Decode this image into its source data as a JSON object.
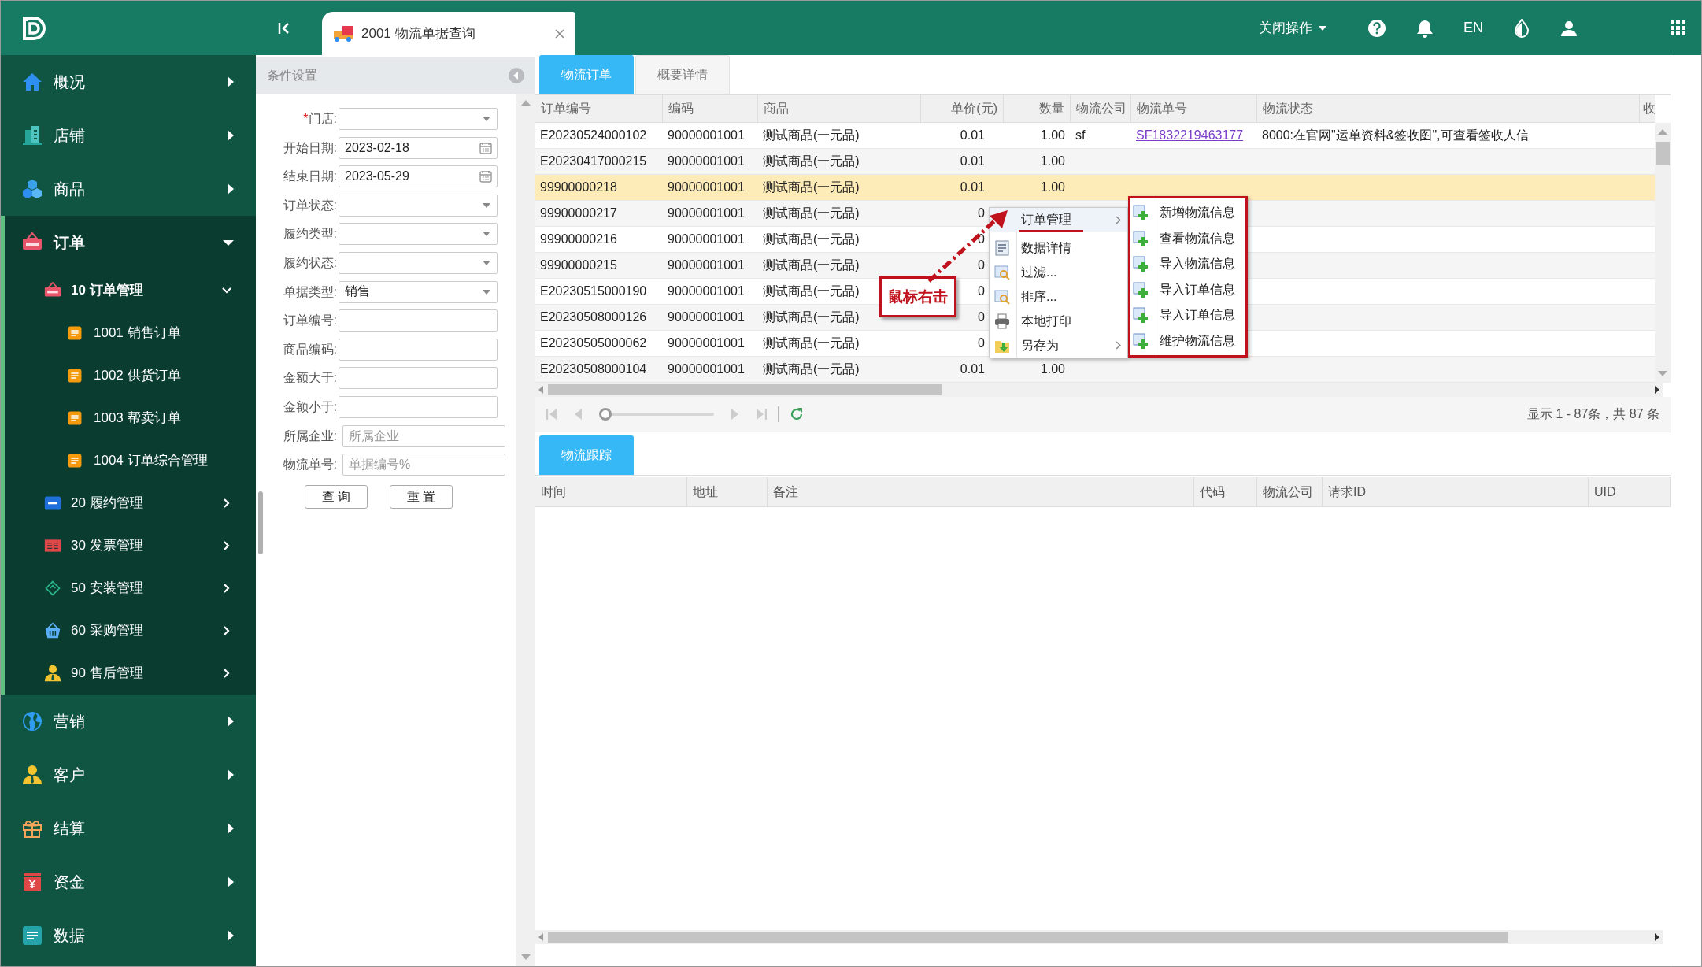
{
  "header": {
    "tab": {
      "title": "2001 物流单据查询"
    },
    "close_ops": "关闭操作",
    "language": "EN"
  },
  "sidebar": {
    "items": [
      {
        "label": "概况",
        "expanded": false
      },
      {
        "label": "店铺",
        "expanded": false
      },
      {
        "label": "商品",
        "expanded": false
      },
      {
        "label": "订单",
        "expanded": true,
        "children": [
          {
            "label": "10 订单管理",
            "expanded": true,
            "children": [
              {
                "label": "1001 销售订单"
              },
              {
                "label": "1002 供货订单"
              },
              {
                "label": "1003 帮卖订单"
              },
              {
                "label": "1004 订单综合管理"
              }
            ]
          },
          {
            "label": "20 履约管理",
            "expanded": false
          },
          {
            "label": "30 发票管理",
            "expanded": false
          },
          {
            "label": "50 安装管理",
            "expanded": false
          },
          {
            "label": "60 采购管理",
            "expanded": false
          },
          {
            "label": "90 售后管理",
            "expanded": false
          }
        ]
      },
      {
        "label": "营销",
        "expanded": false
      },
      {
        "label": "客户",
        "expanded": false
      },
      {
        "label": "结算",
        "expanded": false
      },
      {
        "label": "资金",
        "expanded": false
      },
      {
        "label": "数据",
        "expanded": false
      }
    ]
  },
  "filter_panel": {
    "title": "条件设置",
    "fields": [
      {
        "label": "门店:",
        "required_mark": "*",
        "kind": "select"
      },
      {
        "label": "开始日期:",
        "kind": "date",
        "value": "2023-02-18"
      },
      {
        "label": "结束日期:",
        "kind": "date",
        "value": "2023-05-29"
      },
      {
        "label": "订单状态:",
        "kind": "select"
      },
      {
        "label": "履约类型:",
        "kind": "select"
      },
      {
        "label": "履约状态:",
        "kind": "select"
      },
      {
        "label": "单据类型:",
        "kind": "select",
        "value": "销售"
      },
      {
        "label": "订单编号:",
        "kind": "text"
      },
      {
        "label": "商品编码:",
        "kind": "text"
      },
      {
        "label": "金额大于:",
        "kind": "text"
      },
      {
        "label": "金额小于:",
        "kind": "text"
      },
      {
        "label": "所属企业:",
        "kind": "text",
        "placeholder": "所属企业"
      },
      {
        "label": "物流单号:",
        "kind": "text",
        "placeholder": "单据编号%"
      }
    ],
    "buttons": [
      "查 询",
      "重 置"
    ]
  },
  "main": {
    "tabs": [
      {
        "label": "物流订单",
        "selected": true
      },
      {
        "label": "概要详情",
        "selected": false
      }
    ],
    "table": {
      "columns": [
        "订单编号",
        "编码",
        "商品",
        "单价(元)",
        "数量",
        "物流公司",
        "物流单号",
        "物流状态",
        "收"
      ],
      "rows": [
        {
          "selected": false,
          "order_no": "E20230524000102",
          "code": "90000001001",
          "product": "测试商品(一元品)",
          "price": "0.01",
          "qty": "1.00",
          "carrier": "sf",
          "tracking_no": "SF1832219463177",
          "status": "8000:在官网\"运单资料&签收图\",可查看签收人信"
        },
        {
          "selected": false,
          "order_no": "E20230417000215",
          "code": "90000001001",
          "product": "测试商品(一元品)",
          "price": "0.01",
          "qty": "1.00"
        },
        {
          "selected": true,
          "order_no": "99900000218",
          "code": "90000001001",
          "product": "测试商品(一元品)",
          "price": "0.01",
          "qty": "1.00"
        },
        {
          "selected": false,
          "order_no": "99900000217",
          "code": "90000001001",
          "product": "测试商品(一元品)",
          "price": "0"
        },
        {
          "selected": false,
          "order_no": "99900000216",
          "code": "90000001001",
          "product": "测试商品(一元品)",
          "price": "0"
        },
        {
          "selected": false,
          "order_no": "99900000215",
          "code": "90000001001",
          "product": "测试商品(一元品)",
          "price": "0"
        },
        {
          "selected": false,
          "order_no": "E20230515000190",
          "code": "90000001001",
          "product": "测试商品(一元品)",
          "price": "0"
        },
        {
          "selected": false,
          "order_no": "E20230508000126",
          "code": "90000001001",
          "product": "测试商品(一元品)",
          "price": "0"
        },
        {
          "selected": false,
          "order_no": "E20230505000062",
          "code": "90000001001",
          "product": "测试商品(一元品)",
          "price": "0"
        },
        {
          "selected": false,
          "order_no": "E20230508000104",
          "code": "90000001001",
          "product": "测试商品(一元品)",
          "price": "0.01",
          "qty": "1.00"
        }
      ]
    },
    "context_menu": {
      "items": [
        {
          "label": "订单管理",
          "selected": true,
          "has_submenu": true,
          "separator_after": true
        },
        {
          "label": "数据详情",
          "selected": false,
          "has_submenu": false
        },
        {
          "label": "过滤...",
          "selected": false,
          "has_submenu": false
        },
        {
          "label": "排序...",
          "selected": false,
          "has_submenu": false
        },
        {
          "label": "本地打印",
          "selected": false,
          "has_submenu": false
        },
        {
          "label": "另存为",
          "selected": false,
          "has_submenu": true
        }
      ],
      "submenu": [
        "新增物流信息",
        "查看物流信息",
        "导入物流信息",
        "导入订单信息",
        "导入订单信息",
        "维护物流信息"
      ]
    },
    "pager": {
      "level": 0,
      "summary": "显示 1 - 87条，共 87 条"
    },
    "tracking": {
      "tabs": [
        {
          "label": "物流跟踪",
          "selected": true
        }
      ],
      "columns": [
        "时间",
        "地址",
        "备注",
        "代码",
        "物流公司",
        "请求ID",
        "UID"
      ]
    }
  },
  "annotation": {
    "label": "鼠标右击"
  }
}
